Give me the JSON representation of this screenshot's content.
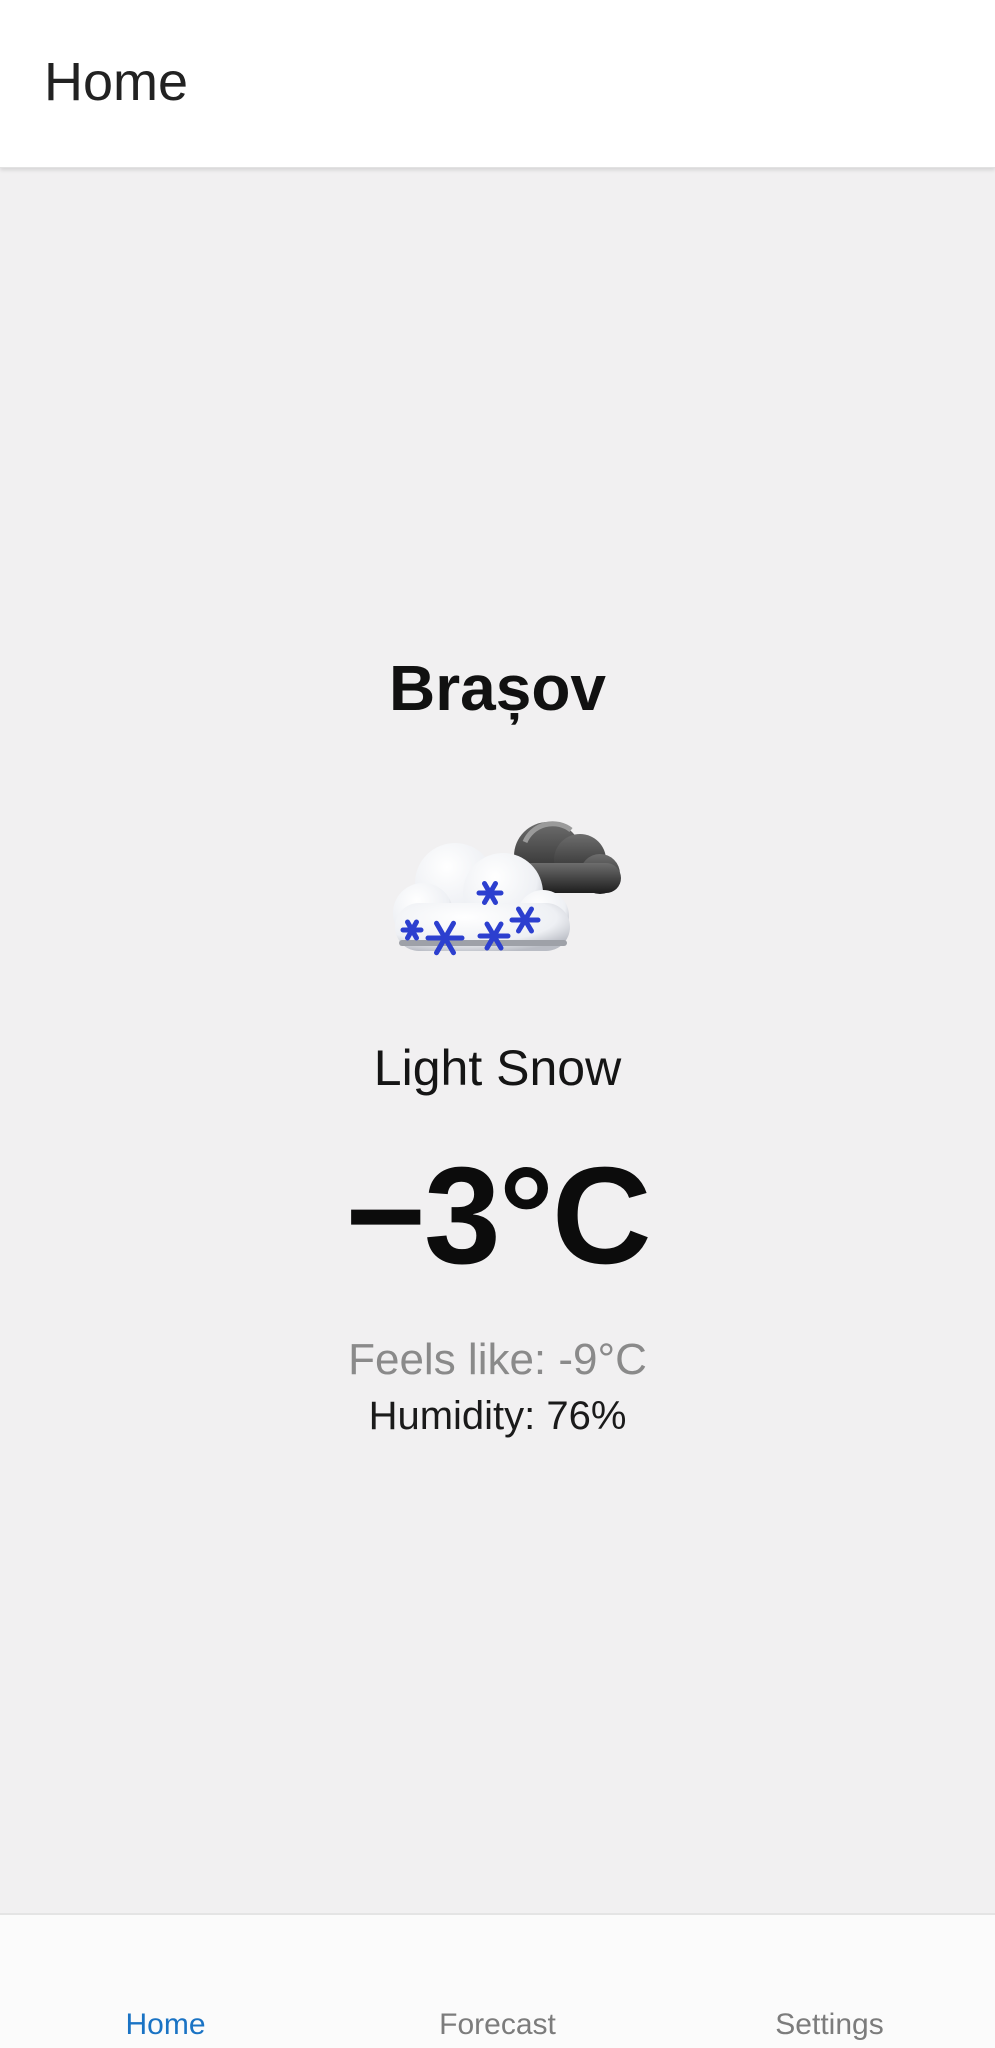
{
  "app_bar": {
    "title": "Home"
  },
  "weather": {
    "city": "Brașov",
    "icon": "snow-cloud-icon",
    "condition": "Light Snow",
    "temperature": "−3°C",
    "feels_like": "Feels like: -9°C",
    "humidity": "Humidity: 76%"
  },
  "bottom_nav": {
    "items": [
      {
        "label": "Home",
        "active": true
      },
      {
        "label": "Forecast",
        "active": false
      },
      {
        "label": "Settings",
        "active": false
      }
    ],
    "active_color": "#1a73c4",
    "inactive_color": "#7c7c7c"
  }
}
